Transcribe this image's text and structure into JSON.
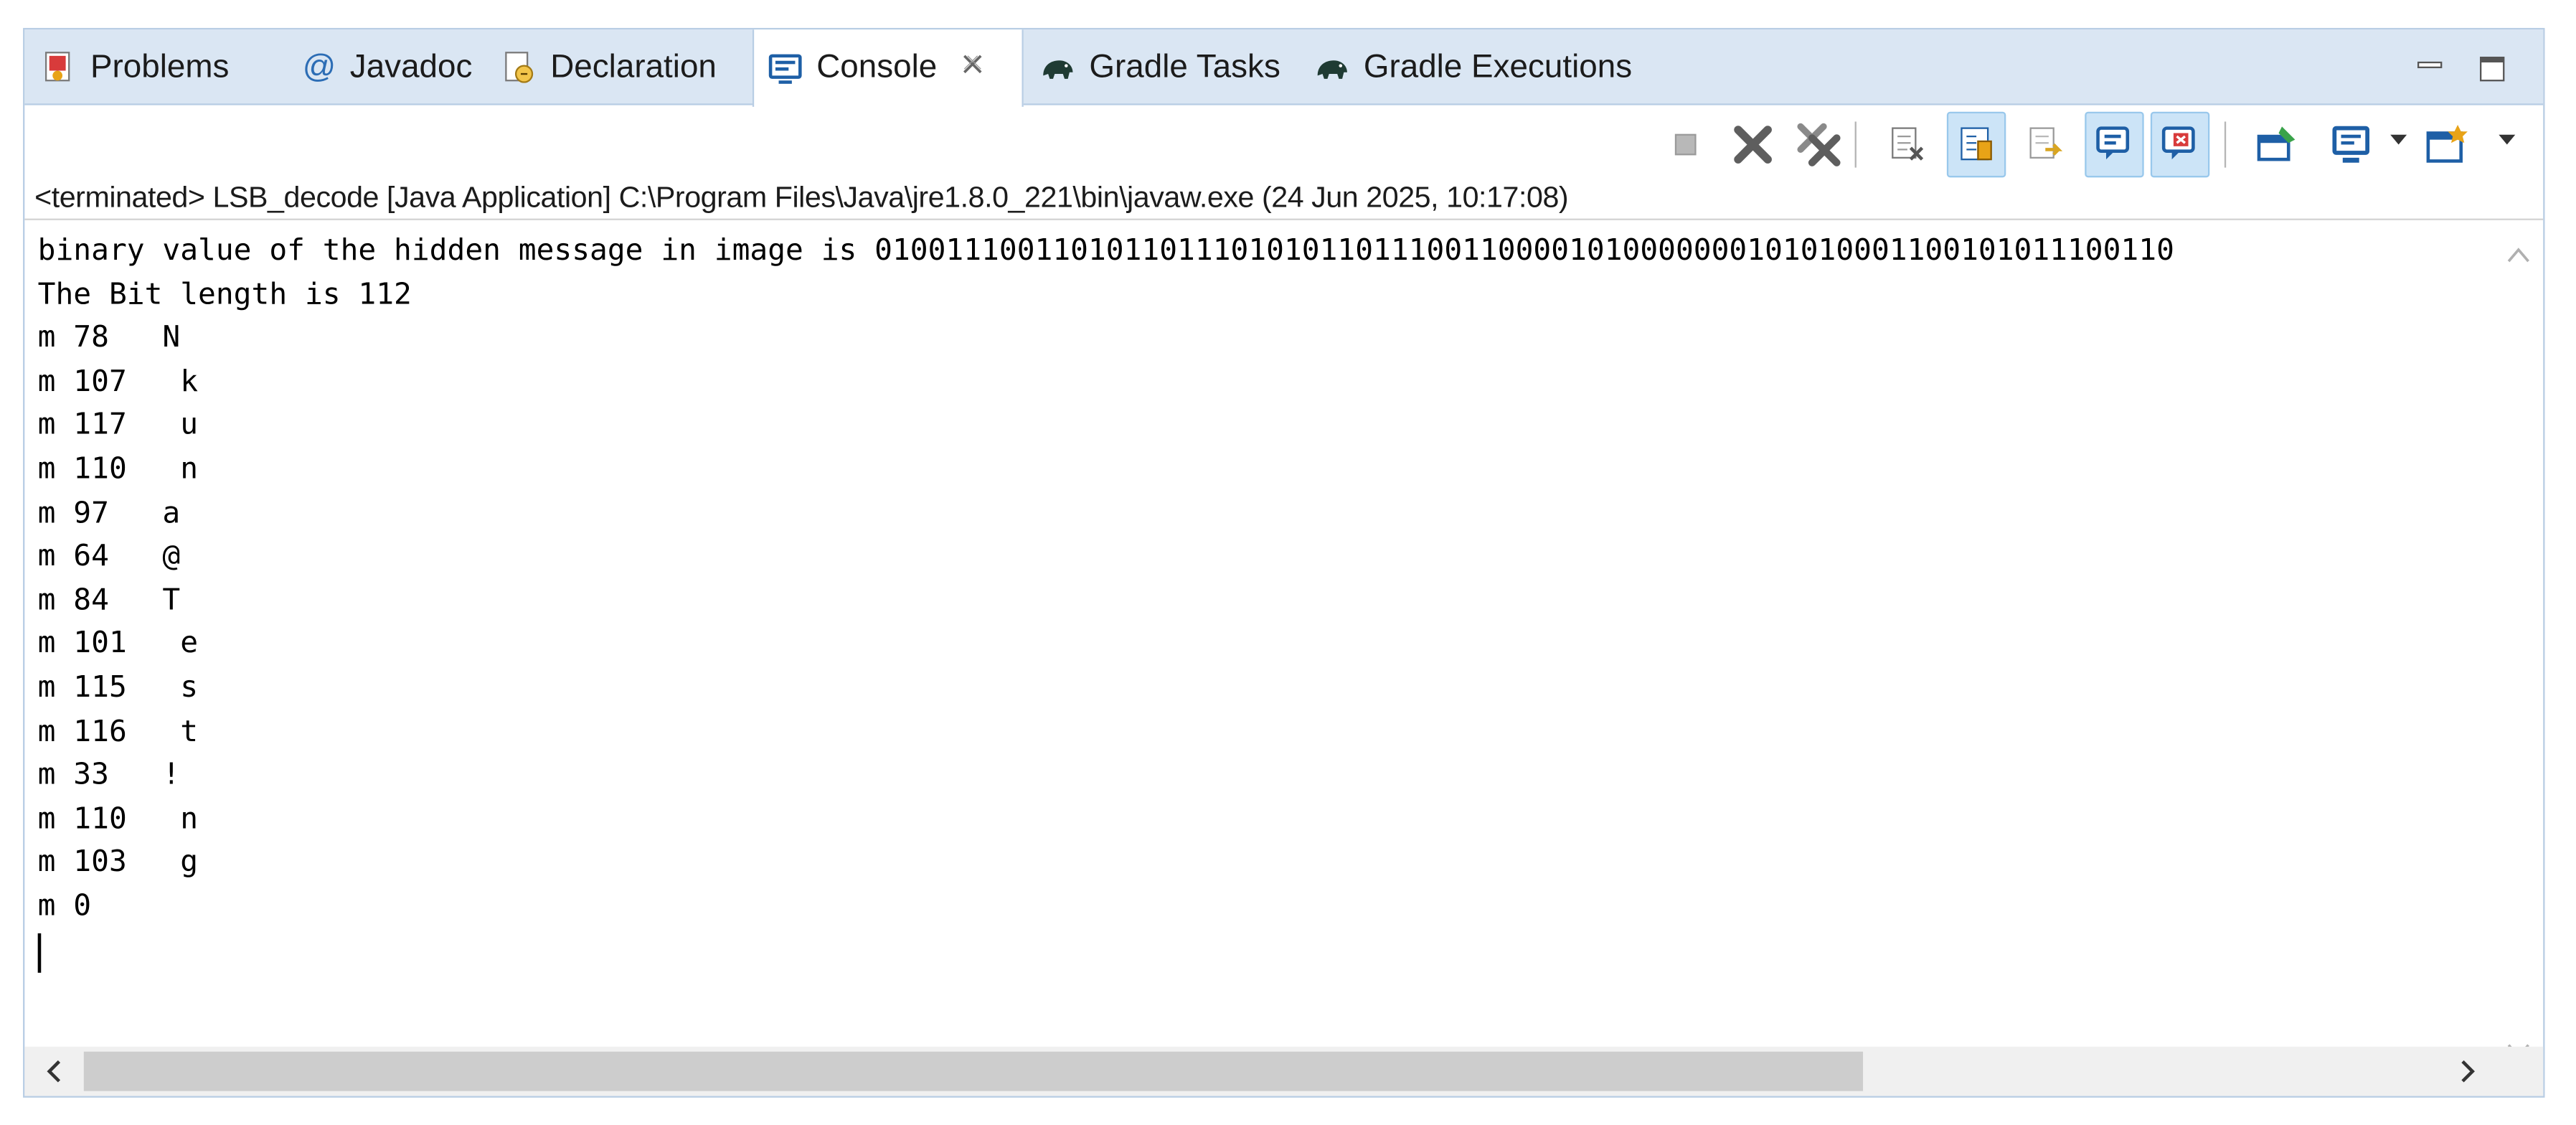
{
  "tabs": [
    {
      "label": "Problems",
      "icon": "problems-icon"
    },
    {
      "label": "Javadoc",
      "icon": "javadoc-at-icon",
      "glyph": "@"
    },
    {
      "label": "Declaration",
      "icon": "declaration-icon"
    },
    {
      "label": "Console",
      "icon": "console-icon",
      "active": true
    },
    {
      "label": "Gradle Tasks",
      "icon": "gradle-elephant-icon"
    },
    {
      "label": "Gradle Executions",
      "icon": "gradle-elephant-icon"
    }
  ],
  "toolbar": {
    "icons": [
      "terminate-icon",
      "remove-launch-icon",
      "remove-all-terminated-icon",
      "clear-console-icon",
      "scroll-lock-icon",
      "word-wrap-icon",
      "show-on-stdout-icon",
      "show-on-stderr-icon",
      "pin-console-icon",
      "display-console-icon",
      "open-console-icon"
    ]
  },
  "status_line": "<terminated> LSB_decode [Java Application] C:\\Program Files\\Java\\jre1.8.0_221\\bin\\javaw.exe  (24 Jun 2025, 10:17:08)",
  "console_lines": [
    "binary value of the hidden message in image is 0100111001101011011101010110111001100001010000000101010001100101011100110",
    "The Bit length is 112",
    "m 78   N",
    "m 107   k",
    "m 117   u",
    "m 110   n",
    "m 97   a",
    "m 64   @",
    "m 84   T",
    "m 101   e",
    "m 115   s",
    "m 116   t",
    "m 33   !",
    "m 110   n",
    "m 103   g",
    "m 0"
  ],
  "colors": {
    "tabbar_bg": "#dae6f3",
    "accent_blue": "#1e5fa6",
    "selected_tool": "#cce4f7"
  }
}
